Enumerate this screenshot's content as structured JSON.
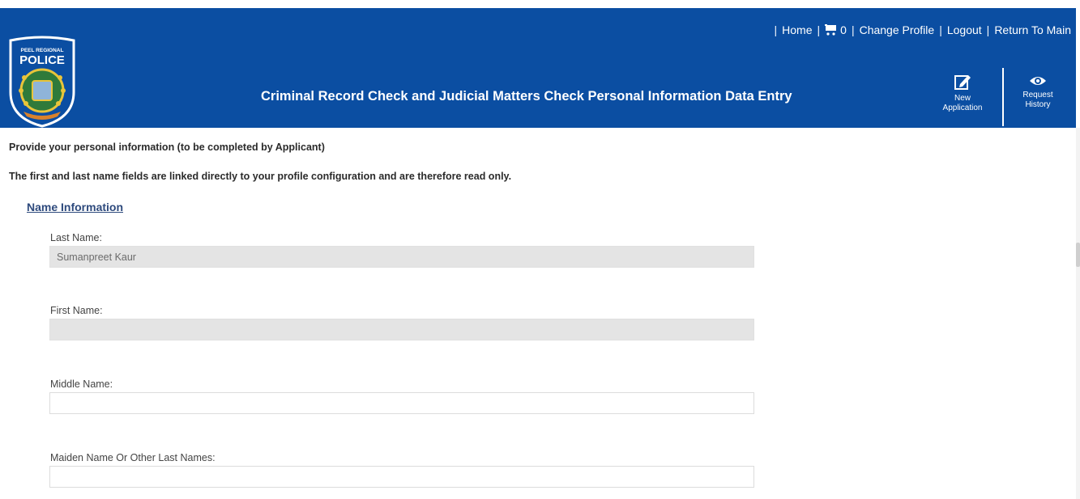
{
  "header": {
    "logo": {
      "org_small": "PEEL REGIONAL",
      "org_big": "POLICE"
    },
    "nav": {
      "home": "Home",
      "cart_count": "0",
      "change_profile": "Change Profile",
      "logout": "Logout",
      "return_main": "Return To Main",
      "separator": "|"
    },
    "title": "Criminal Record Check and Judicial Matters Check Personal Information Data Entry",
    "tools": {
      "new_application_line1": "New",
      "new_application_line2": "Application",
      "request_history_line1": "Request",
      "request_history_line2": "History"
    },
    "colors": {
      "bar": "#0b4ea2",
      "text": "#ffffff"
    }
  },
  "content": {
    "intro1": "Provide your personal information (to be completed by Applicant)",
    "intro2": "The first and last name fields are linked directly to your profile configuration and are therefore read only.",
    "section_title": "Name Information",
    "fields": {
      "last_name": {
        "label": "Last Name:",
        "value": "Sumanpreet Kaur"
      },
      "first_name": {
        "label": "First Name:",
        "value": ""
      },
      "middle_name": {
        "label": "Middle Name:",
        "value": ""
      },
      "maiden_name": {
        "label": "Maiden Name Or Other Last Names:",
        "value": ""
      }
    }
  }
}
